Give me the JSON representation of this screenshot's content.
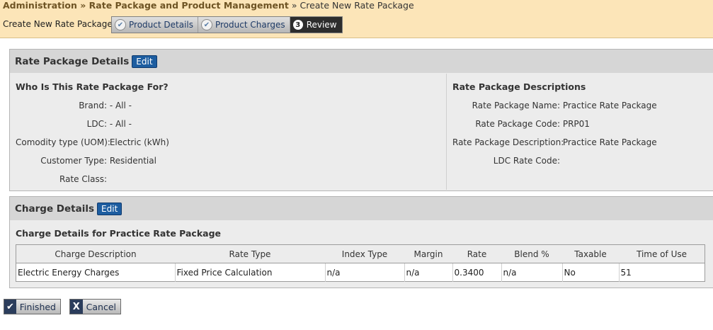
{
  "breadcrumb": {
    "part1": "Administration",
    "sep1": " » ",
    "part2": "Rate Package and Product Management",
    "sep2": " » ",
    "part3": "Create New Rate Package"
  },
  "wizard": {
    "label": "Create New Rate Package",
    "steps": [
      {
        "label": "Product Details",
        "state": "done"
      },
      {
        "label": "Product Charges",
        "state": "done"
      },
      {
        "label": "Review",
        "number": "3",
        "state": "active"
      }
    ]
  },
  "details_panel": {
    "title": "Rate Package Details",
    "edit_label": "Edit",
    "left_title": "Who Is This Rate Package For?",
    "left_rows": [
      {
        "label": "Brand:",
        "value": "- All -"
      },
      {
        "label": "LDC:",
        "value": "- All -"
      },
      {
        "label": "Comodity type (UOM):",
        "value": "Electric (kWh)"
      },
      {
        "label": "Customer Type:",
        "value": "Residential"
      },
      {
        "label": "Rate Class:",
        "value": ""
      }
    ],
    "right_title": "Rate Package Descriptions",
    "right_rows": [
      {
        "label": "Rate Package Name:",
        "value": "Practice Rate Package"
      },
      {
        "label": "Rate Package Code:",
        "value": "PRP01"
      },
      {
        "label": "Rate Package Description:",
        "value": "Practice Rate Package"
      },
      {
        "label": "LDC Rate Code:",
        "value": ""
      }
    ]
  },
  "charges_panel": {
    "title": "Charge Details",
    "edit_label": "Edit",
    "subtitle": "Charge Details for Practice Rate Package",
    "columns": [
      "Charge Description",
      "Rate Type",
      "Index Type",
      "Margin",
      "Rate",
      "Blend %",
      "Taxable",
      "Time of Use"
    ],
    "rows": [
      [
        "Electric Energy Charges",
        "Fixed Price Calculation",
        "n/a",
        "n/a",
        "0.3400",
        "n/a",
        "No",
        "51"
      ]
    ]
  },
  "actions": {
    "finished_label": "Finished",
    "cancel_label": "Cancel",
    "cancel_icon": "X"
  }
}
